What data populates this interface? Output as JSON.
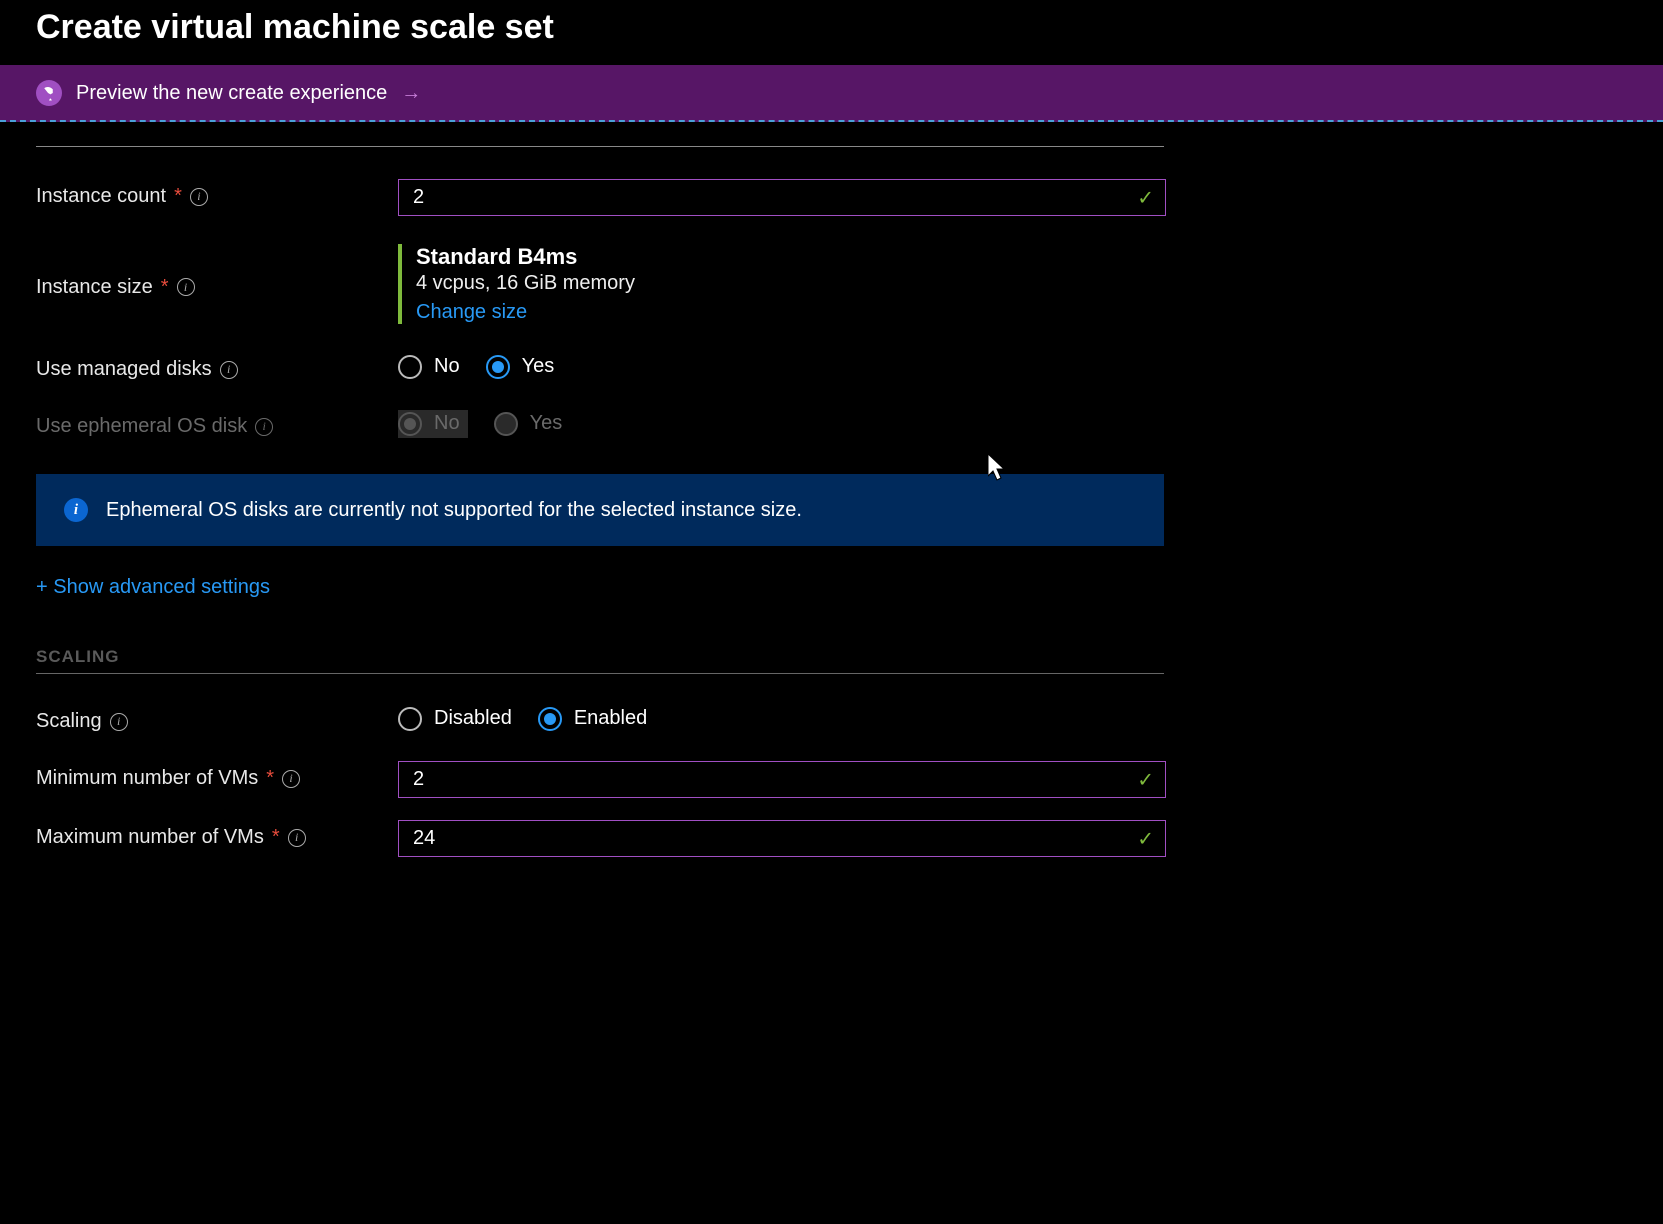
{
  "header": {
    "title": "Create virtual machine scale set"
  },
  "previewBanner": {
    "text": "Preview the new create experience"
  },
  "form": {
    "instanceCount": {
      "label": "Instance count",
      "value": "2"
    },
    "instanceSize": {
      "label": "Instance size",
      "name": "Standard B4ms",
      "specs": "4 vcpus, 16 GiB memory",
      "changeLink": "Change size"
    },
    "managedDisks": {
      "label": "Use managed disks",
      "no": "No",
      "yes": "Yes",
      "selected": "yes"
    },
    "ephemeralDisk": {
      "label": "Use ephemeral OS disk",
      "no": "No",
      "yes": "Yes",
      "selected": "no"
    },
    "ephemeralInfo": "Ephemeral OS disks are currently not supported for the selected instance size.",
    "advancedLink": "+ Show advanced settings"
  },
  "scaling": {
    "sectionTitle": "SCALING",
    "scaling": {
      "label": "Scaling",
      "disabled": "Disabled",
      "enabled": "Enabled",
      "selected": "enabled"
    },
    "minVMs": {
      "label": "Minimum number of VMs",
      "value": "2"
    },
    "maxVMs": {
      "label": "Maximum number of VMs",
      "value": "24"
    }
  }
}
